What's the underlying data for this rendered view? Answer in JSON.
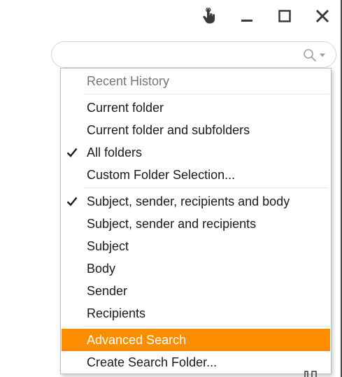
{
  "titlebar": {
    "icons": [
      "touch-hand-icon",
      "minimize-icon",
      "maximize-icon",
      "close-icon"
    ]
  },
  "search": {
    "value": "",
    "placeholder": "",
    "icons": [
      "search-icon",
      "dropdown-arrow-icon"
    ]
  },
  "menu": {
    "header": "Recent History",
    "scope_items": [
      {
        "label": "Current folder",
        "checked": false
      },
      {
        "label": "Current folder and subfolders",
        "checked": false
      },
      {
        "label": "All folders",
        "checked": true
      },
      {
        "label": "Custom Folder Selection...",
        "checked": false
      }
    ],
    "field_items": [
      {
        "label": "Subject, sender, recipients and body",
        "checked": true
      },
      {
        "label": "Subject, sender and recipients",
        "checked": false
      },
      {
        "label": "Subject",
        "checked": false
      },
      {
        "label": "Body",
        "checked": false
      },
      {
        "label": "Sender",
        "checked": false
      },
      {
        "label": "Recipients",
        "checked": false
      }
    ],
    "advanced_search": "Advanced Search",
    "create_search_folder": "Create Search Folder..."
  },
  "colors": {
    "highlight": "#fd8d00",
    "header_text": "#767676",
    "icon": "#3a3a3a"
  }
}
